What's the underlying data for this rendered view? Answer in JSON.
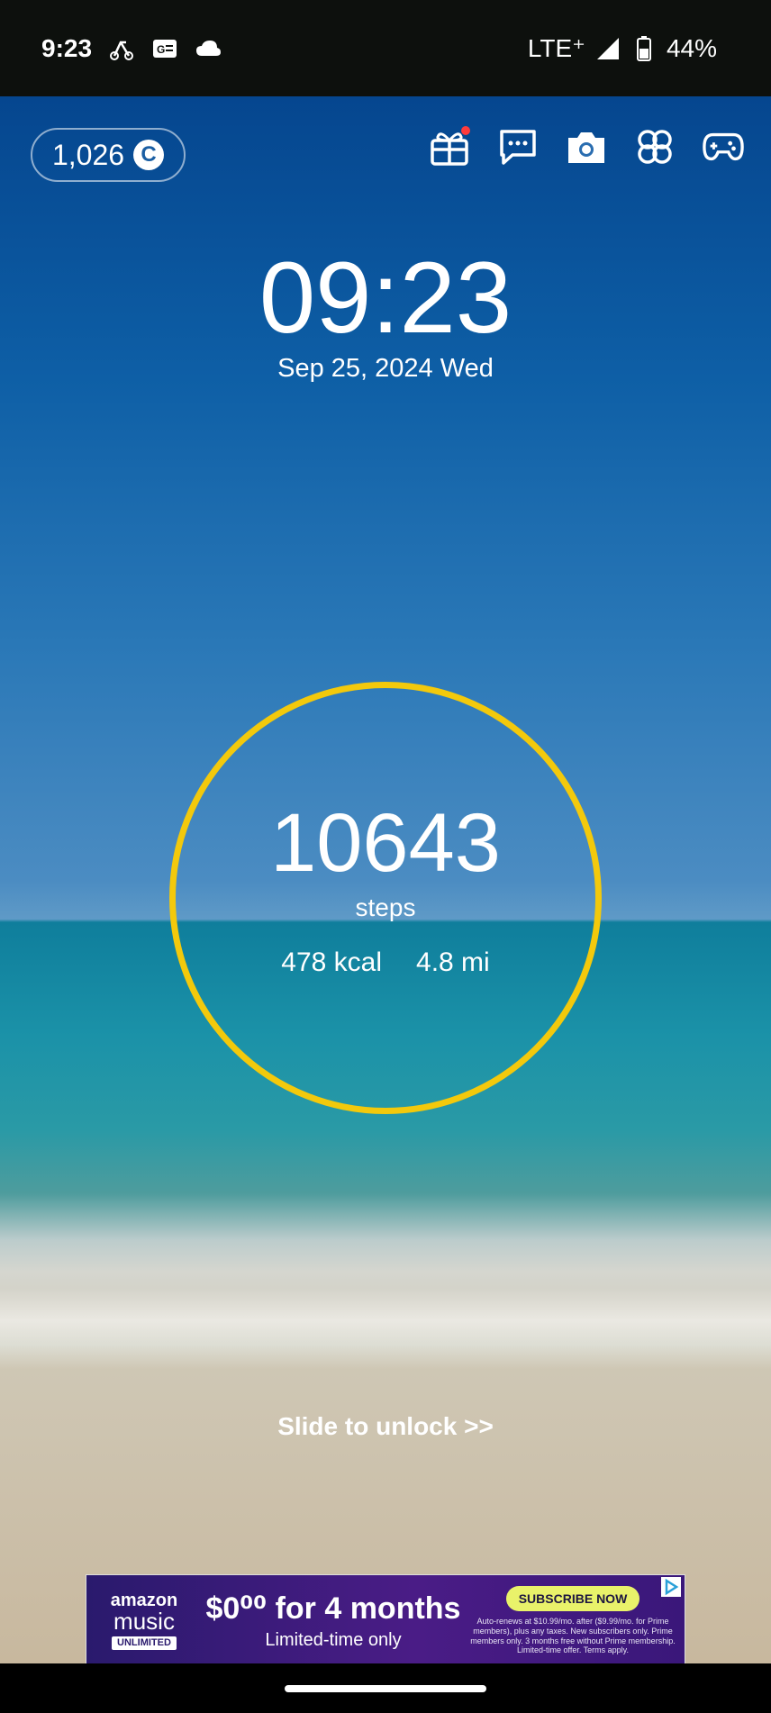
{
  "status_bar": {
    "time": "9:23",
    "network": "LTE⁺",
    "battery": "44%",
    "left_icons": [
      "scooter-icon",
      "news-icon",
      "cloud-icon"
    ],
    "right_icons": [
      "signal-icon",
      "battery-icon"
    ]
  },
  "coins": {
    "amount": "1,026",
    "badge": "C"
  },
  "top_icons": [
    "gift-icon",
    "chat-icon",
    "camera-icon",
    "clover-icon",
    "gamepad-icon"
  ],
  "clock": {
    "time": "09:23",
    "date": "Sep 25, 2024 Wed"
  },
  "steps": {
    "count": "10643",
    "label": "steps",
    "kcal": "478 kcal",
    "distance": "4.8 mi",
    "ring_color": "#f3c90c"
  },
  "unlock": {
    "label": "Slide to unlock >>"
  },
  "ad": {
    "brand_line1": "amazon",
    "brand_line2": "music",
    "brand_line3": "UNLIMITED",
    "headline": "$0⁰⁰ for 4 months",
    "subline": "Limited-time only",
    "cta": "SUBSCRIBE NOW",
    "fine_print": "Auto-renews at $10.99/mo. after ($9.99/mo. for Prime members), plus any taxes. New subscribers only. Prime members only. 3 months free without Prime membership. Limited-time offer. Terms apply."
  }
}
